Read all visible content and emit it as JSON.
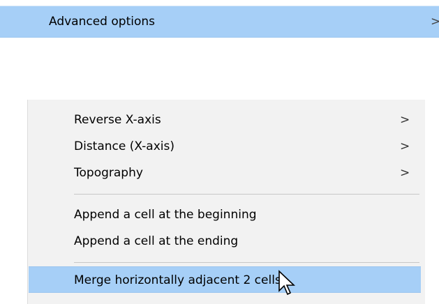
{
  "top_item": {
    "label": "Advanced options",
    "chevron": ">"
  },
  "menu": {
    "items": [
      {
        "label": "Reverse X-axis",
        "chevron": ">"
      },
      {
        "label": "Distance (X-axis)",
        "chevron": ">"
      },
      {
        "label": "Topography",
        "chevron": ">"
      },
      {
        "label": "Append a cell at the beginning"
      },
      {
        "label": "Append a cell at the ending"
      },
      {
        "label": "Merge horizontally adjacent 2 cells"
      }
    ]
  },
  "cursor": {
    "icon": "arrow-pointer-icon"
  },
  "colors": {
    "highlight": "#a6cff7",
    "menu_background": "#f2f2f2",
    "separator": "#c7c7c7"
  }
}
